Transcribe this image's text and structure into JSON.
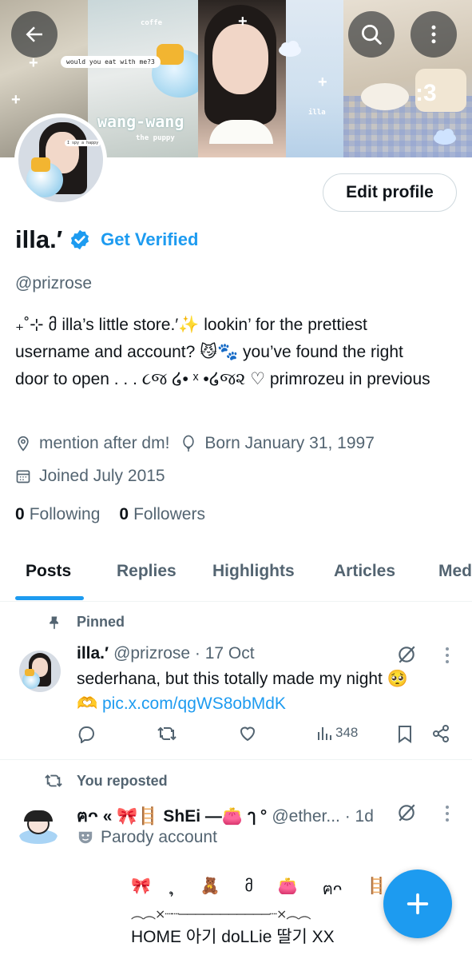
{
  "banner": {
    "bubble_text": "would you eat with me?3",
    "title_text": "wang-wang",
    "subtitle_text": "the puppy",
    "coffee_text": "coffe",
    "illa_text": "illa",
    "number_text": ":3",
    "avatar_tag": "I spy a happy"
  },
  "toolbar": {
    "back_icon": "arrow-left-icon",
    "search_icon": "search-icon",
    "more_icon": "more-vertical-icon"
  },
  "profile": {
    "edit_label": "Edit profile",
    "display_name": "illa.′",
    "get_verified": "Get Verified",
    "handle": "@prizrose",
    "bio_line1": "₊˚⊹ მ illa’s little store.′✨ lookin’ for the prettiest",
    "bio_line2": "username and account? 😼🐾 you’ve found the right",
    "bio_line3": "door to open . . . ૮જ ໒• ˣ •໒જ૨ ♡ primrozeu in previous",
    "location": "mention after dm!",
    "birthday": "Born January 31, 1997",
    "joined": "Joined July 2015",
    "following_count": "0",
    "following_label": "Following",
    "followers_count": "0",
    "followers_label": "Followers"
  },
  "tabs": [
    {
      "label": "Posts",
      "active": true
    },
    {
      "label": "Replies"
    },
    {
      "label": "Highlights"
    },
    {
      "label": "Articles"
    },
    {
      "label": "Media"
    }
  ],
  "posts": [
    {
      "context": "Pinned",
      "name": "illa.′",
      "meta": "@prizrose · 17 Oct",
      "text_line1": "sederhana, but this totally made my night 🥺",
      "text_line2_emoji": "🫶",
      "link": "pic.x.com/qgWS8obMdK",
      "views": "348"
    },
    {
      "context": "You reposted",
      "name": "ฅᴖ « 🎀🪜 ShEi —👛 ๅ °",
      "meta": "@ether... · 1d",
      "parody": "Parody account",
      "emoji_row": [
        "🎀",
        "ຸ",
        "🧸",
        "მ",
        "👛",
        "ฅᴖ",
        "🪜"
      ],
      "deco_line": "︵︵⨯┈┈───────────┈⨯︵︵",
      "home_line": "HOME  아기  doLLie  딸기  XX"
    }
  ],
  "colors": {
    "accent": "#1d9bf0",
    "text_primary": "#0f1419",
    "text_secondary": "#536471",
    "divider": "#eff3f4"
  },
  "fab": {
    "icon": "plus-icon"
  }
}
